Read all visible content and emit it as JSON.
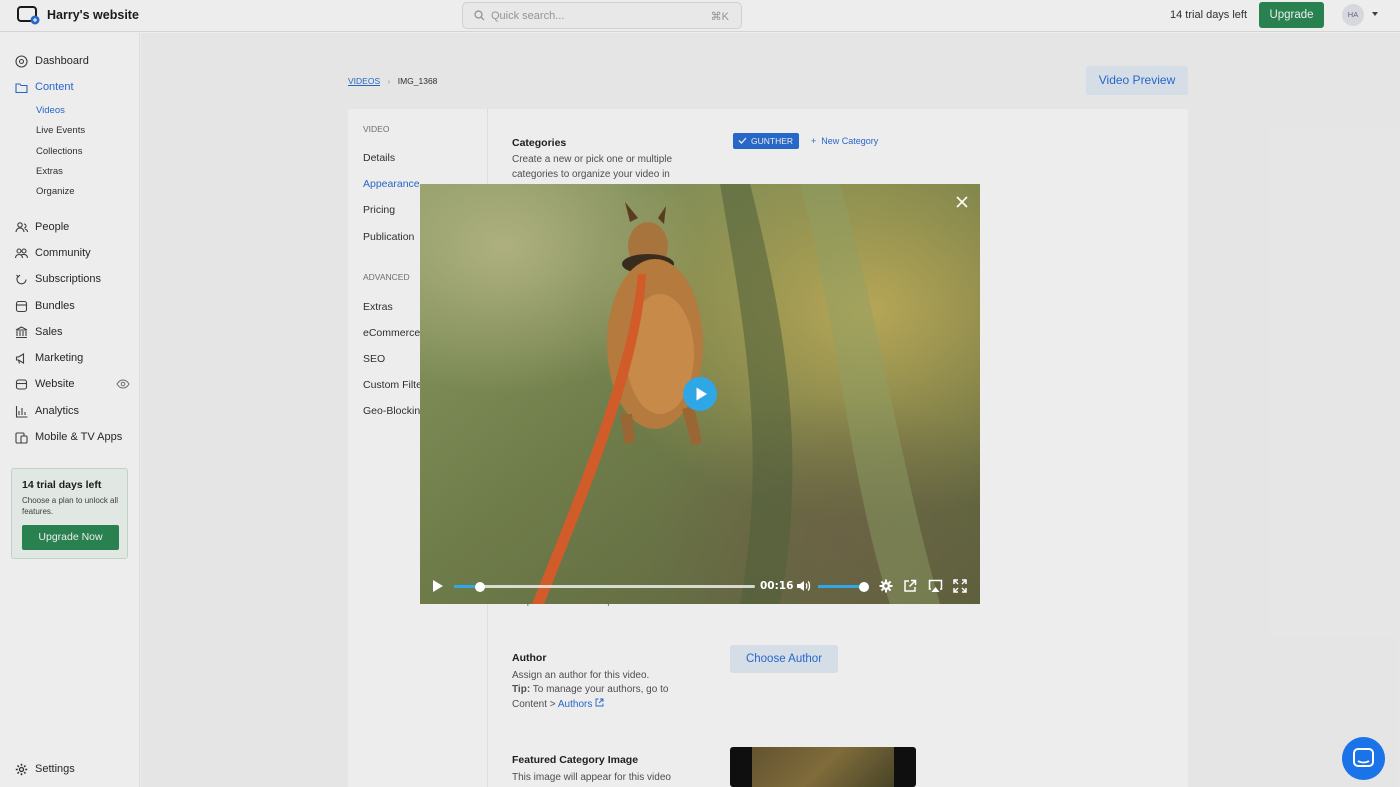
{
  "topbar": {
    "site_name": "Harry's website",
    "search_placeholder": "Quick search...",
    "search_shortcut": "⌘K",
    "trial_text": "14 trial days left",
    "upgrade_label": "Upgrade",
    "avatar_initials": "HA"
  },
  "sidebar": {
    "items": [
      {
        "label": "Dashboard",
        "icon": "dashboard-icon"
      },
      {
        "label": "Content",
        "icon": "folder-icon",
        "active": true
      },
      {
        "label": "People",
        "icon": "people-icon"
      },
      {
        "label": "Community",
        "icon": "community-icon"
      },
      {
        "label": "Subscriptions",
        "icon": "subscriptions-icon"
      },
      {
        "label": "Bundles",
        "icon": "bundles-icon"
      },
      {
        "label": "Sales",
        "icon": "sales-icon"
      },
      {
        "label": "Marketing",
        "icon": "marketing-icon"
      },
      {
        "label": "Website",
        "icon": "website-icon"
      },
      {
        "label": "Analytics",
        "icon": "analytics-icon"
      },
      {
        "label": "Mobile & TV Apps",
        "icon": "mobile-icon"
      }
    ],
    "content_sub": [
      "Videos",
      "Live Events",
      "Collections",
      "Extras",
      "Organize"
    ],
    "trial_box": {
      "title": "14 trial days left",
      "text": "Choose a plan to unlock all features.",
      "button": "Upgrade Now"
    },
    "settings_label": "Settings"
  },
  "breadcrumb": {
    "parent": "VIDEOS",
    "current": "IMG_1368"
  },
  "video_preview_button": "Video Preview",
  "video_nav": {
    "video_heading": "VIDEO",
    "video_items": [
      "Details",
      "Appearance",
      "Pricing",
      "Publication"
    ],
    "advanced_heading": "ADVANCED",
    "advanced_items": [
      "Extras",
      "eCommerce",
      "SEO",
      "Custom Filte",
      "Geo-Blockin"
    ]
  },
  "form": {
    "categories_title": "Categories",
    "categories_desc_1": "Create a new or pick one or multiple",
    "categories_desc_2": "categories to organize your video in",
    "category_chip": "GUNTHER",
    "new_category": "New Category",
    "partial_text": "it's preview in default pool.",
    "author_title": "Author",
    "author_desc": "Assign an author for this video.",
    "author_tip_label": "Tip:",
    "author_tip": "To manage your authors, go to",
    "author_tip_path": "Content >",
    "author_tip_link": "Authors",
    "choose_author": "Choose Author",
    "featured_title": "Featured Category Image",
    "featured_desc": "This image will appear for this video"
  },
  "player": {
    "time": "00:16",
    "progress": 0.085,
    "volume": 1.0,
    "colors": {
      "accent": "#2fa6e6"
    }
  }
}
